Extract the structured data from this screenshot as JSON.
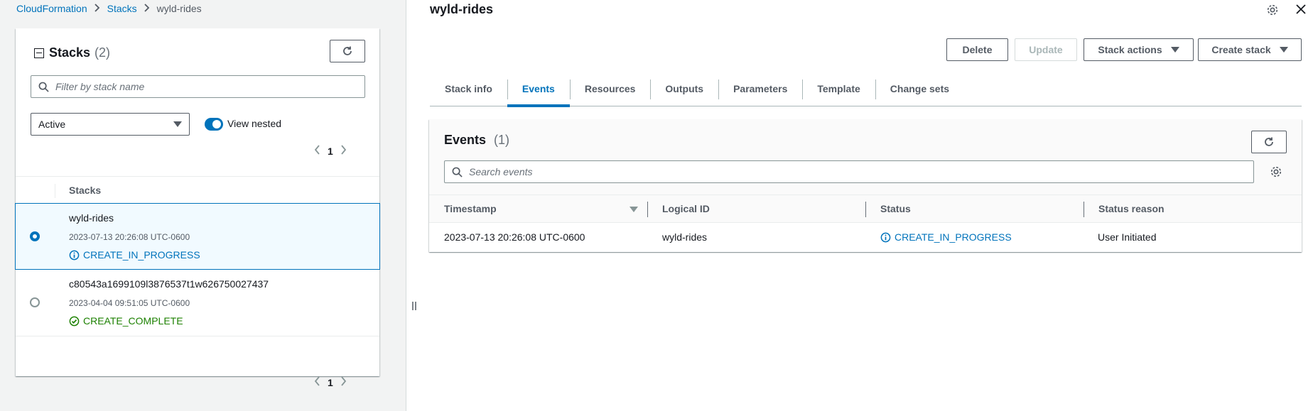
{
  "breadcrumb": {
    "items": [
      "CloudFormation",
      "Stacks",
      "wyld-rides"
    ]
  },
  "left_panel": {
    "title": "Stacks",
    "count": "(2)",
    "filter_placeholder": "Filter by stack name",
    "status_filter": "Active",
    "view_nested_label": "View nested",
    "view_nested_on": true,
    "page": "1",
    "column_header": "Stacks",
    "stacks": [
      {
        "name": "wyld-rides",
        "timestamp": "2023-07-13 20:26:08 UTC-0600",
        "status": "CREATE_IN_PROGRESS",
        "selected": true
      },
      {
        "name": "c80543a1699109l3876537t1w626750027437",
        "timestamp": "2023-04-04 09:51:05 UTC-0600",
        "status": "CREATE_COMPLETE",
        "selected": false
      }
    ]
  },
  "detail": {
    "title": "wyld-rides",
    "buttons": {
      "delete": "Delete",
      "update": "Update",
      "stack_actions": "Stack actions",
      "create_stack": "Create stack"
    },
    "tabs": [
      "Stack info",
      "Events",
      "Resources",
      "Outputs",
      "Parameters",
      "Template",
      "Change sets"
    ],
    "active_tab": "Events"
  },
  "events": {
    "title": "Events",
    "count": "(1)",
    "search_placeholder": "Search events",
    "columns": [
      "Timestamp",
      "Logical ID",
      "Status",
      "Status reason"
    ],
    "rows": [
      {
        "timestamp": "2023-07-13 20:26:08 UTC-0600",
        "logical_id": "wyld-rides",
        "status": "CREATE_IN_PROGRESS",
        "reason": "User Initiated"
      }
    ]
  },
  "colors": {
    "link_blue": "#0073bb",
    "success_green": "#1d8102",
    "text_secondary": "#545b64"
  }
}
